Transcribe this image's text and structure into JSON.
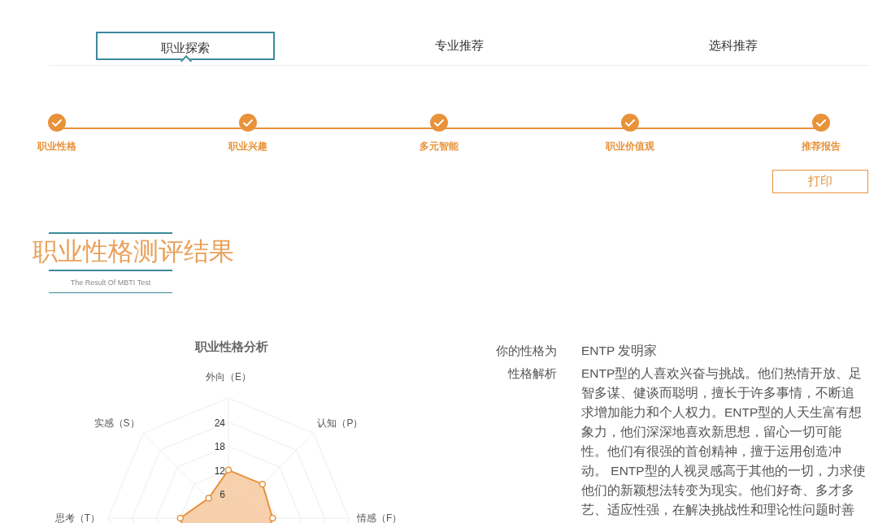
{
  "tabs": [
    {
      "label": "职业探索",
      "selected": true
    },
    {
      "label": "专业推荐",
      "selected": false
    },
    {
      "label": "选科推荐",
      "selected": false
    }
  ],
  "steps": [
    {
      "label": "职业性格",
      "done": true
    },
    {
      "label": "职业兴趣",
      "done": true
    },
    {
      "label": "多元智能",
      "done": true
    },
    {
      "label": "职业价值观",
      "done": true
    },
    {
      "label": "推荐报告",
      "done": true
    }
  ],
  "print_button": "打印",
  "section": {
    "title": "职业性格测评结果",
    "subtitle": "The Result Of MBTI Test"
  },
  "chart": {
    "title": "职业性格分析",
    "axis_labels": [
      "外向（E）",
      "认知（P）",
      "情感（F）",
      "思考（T）",
      "实感（S）"
    ],
    "ticks": [
      "24",
      "18",
      "12",
      "6"
    ]
  },
  "result": [
    {
      "label": "你的性格为",
      "value": "ENTP 发明家"
    },
    {
      "label": "性格解析",
      "value": "ENTP型的人喜欢兴奋与挑战。他们热情开放、足智多谋、健谈而聪明，擅长于许多事情，不断追求增加能力和个人权力。ENTP型的人天生富有想象力，他们深深地喜欢新思想，留心一切可能性。他们有很强的首创精神，擅于运用创造冲动。 ENTP型的人视灵感高于其他的一切，力求使他们的新颖想法转变为现实。他们好奇、多才多艺、适应性强，在解决挑战性和理论性问题时善"
    }
  ]
}
